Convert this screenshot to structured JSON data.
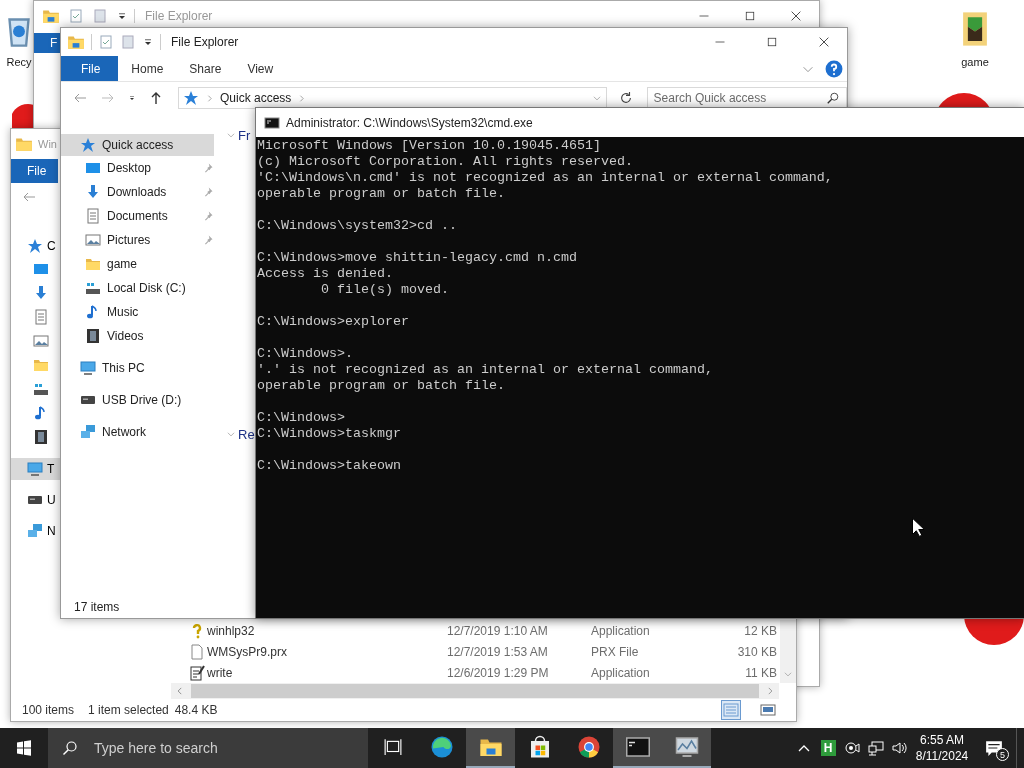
{
  "desktop": {
    "icons": [
      {
        "label": "Recy",
        "kind": "recycle"
      },
      {
        "label": "game",
        "kind": "game"
      }
    ],
    "fragments": [
      {
        "kind": "left"
      },
      {
        "kind": "top-right"
      },
      {
        "kind": "bottom-right"
      }
    ]
  },
  "back_window": {
    "title": "File Explorer",
    "tabs": [
      {
        "label": "F",
        "selected": true
      }
    ]
  },
  "middle_window": {
    "title": "Win",
    "tabs": [
      {
        "label": "File",
        "selected": true
      }
    ],
    "nav": [
      {
        "label": "C",
        "kind": "quick",
        "selected": false,
        "children": [
          {
            "kind": "desktop",
            "selected": false
          },
          {
            "kind": "downloads",
            "selected": false
          },
          {
            "kind": "documents",
            "selected": false
          },
          {
            "kind": "pictures",
            "selected": false
          },
          {
            "kind": "folder",
            "selected": false
          },
          {
            "kind": "disk",
            "selected": false
          },
          {
            "kind": "music",
            "selected": false
          },
          {
            "kind": "videos",
            "selected": false
          }
        ]
      },
      {
        "label": "T",
        "kind": "pc",
        "selected": true
      },
      {
        "label": "U",
        "kind": "usb",
        "selected": false
      },
      {
        "label": "N",
        "kind": "network",
        "selected": false
      }
    ],
    "files": [
      {
        "name": "winhlp32",
        "date": "12/7/2019 1:10 AM",
        "type": "Application",
        "size": "12 KB",
        "kind": "help",
        "selected": false
      },
      {
        "name": "WMSysPr9.prx",
        "date": "12/7/2019 1:53 AM",
        "type": "PRX File",
        "size": "310 KB",
        "kind": "file",
        "selected": false
      },
      {
        "name": "write",
        "date": "12/6/2019 1:29 PM",
        "type": "Application",
        "size": "11 KB",
        "kind": "write",
        "selected": false
      }
    ],
    "status_bar": {
      "items": "100 items",
      "selection": "1 item selected",
      "size": "48.4 KB"
    }
  },
  "front_window": {
    "title": "File Explorer",
    "tabs": [
      {
        "label": "File",
        "selected": true
      },
      {
        "label": "Home",
        "selected": false
      },
      {
        "label": "Share",
        "selected": false
      },
      {
        "label": "View",
        "selected": false
      }
    ],
    "address": {
      "location": "Quick access"
    },
    "search": {
      "placeholder": "Search Quick access"
    },
    "nav": [
      {
        "label": "Quick access",
        "kind": "quick",
        "selected": true,
        "children": [
          {
            "label": "Desktop",
            "kind": "desktop",
            "pinned": true,
            "selected": false
          },
          {
            "label": "Downloads",
            "kind": "downloads",
            "pinned": true,
            "selected": false
          },
          {
            "label": "Documents",
            "kind": "documents",
            "pinned": true,
            "selected": false
          },
          {
            "label": "Pictures",
            "kind": "pictures",
            "pinned": true,
            "selected": false
          },
          {
            "label": "game",
            "kind": "folder",
            "pinned": false,
            "selected": false
          },
          {
            "label": "Local Disk (C:)",
            "kind": "disk",
            "pinned": false,
            "selected": false
          },
          {
            "label": "Music",
            "kind": "music",
            "pinned": false,
            "selected": false
          },
          {
            "label": "Videos",
            "kind": "videos",
            "pinned": false,
            "selected": false
          }
        ]
      },
      {
        "label": "This PC",
        "kind": "pc",
        "selected": false
      },
      {
        "label": "USB Drive (D:)",
        "kind": "usb",
        "selected": false
      },
      {
        "label": "Network",
        "kind": "network",
        "selected": false
      }
    ],
    "groups": [
      {
        "label": "Fr",
        "expanded": true
      },
      {
        "label": "Re",
        "expanded": true
      }
    ],
    "status_bar": "17 items"
  },
  "console": {
    "title": "Administrator: C:\\Windows\\System32\\cmd.exe",
    "blocks": [
      [
        "Microsoft Windows [Version 10.0.19045.4651]",
        "(c) Microsoft Corporation. All rights reserved.",
        "'C:\\Windows\\n.cmd' is not recognized as an internal or external command,",
        "operable program or batch file."
      ],
      [
        "C:\\Windows\\system32>cd .."
      ],
      [
        "C:\\Windows>move shittin-legacy.cmd n.cmd",
        "Access is denied.",
        "        0 file(s) moved."
      ],
      [
        "C:\\Windows>explorer"
      ],
      [
        "C:\\Windows>.",
        "'.' is not recognized as an internal or external command,",
        "operable program or batch file."
      ],
      [
        "C:\\Windows>",
        "C:\\Windows>taskmgr"
      ],
      [
        "C:\\Windows>takeown"
      ]
    ]
  },
  "taskbar": {
    "search": {
      "placeholder": "Type here to search"
    },
    "apps": [
      {
        "kind": "taskview",
        "active": false
      },
      {
        "kind": "edge",
        "active": false
      },
      {
        "kind": "explorer",
        "active": true
      },
      {
        "kind": "store",
        "active": false
      },
      {
        "kind": "chrome",
        "active": false
      },
      {
        "kind": "console",
        "active": true
      },
      {
        "kind": "monitor",
        "active": true
      }
    ],
    "tray": [
      {
        "kind": "overflow"
      },
      {
        "kind": "app",
        "label": "H"
      },
      {
        "kind": "camera"
      },
      {
        "kind": "network"
      },
      {
        "kind": "volume"
      }
    ],
    "time": "6:55 AM",
    "date": "8/11/2024",
    "notifications": "5"
  }
}
